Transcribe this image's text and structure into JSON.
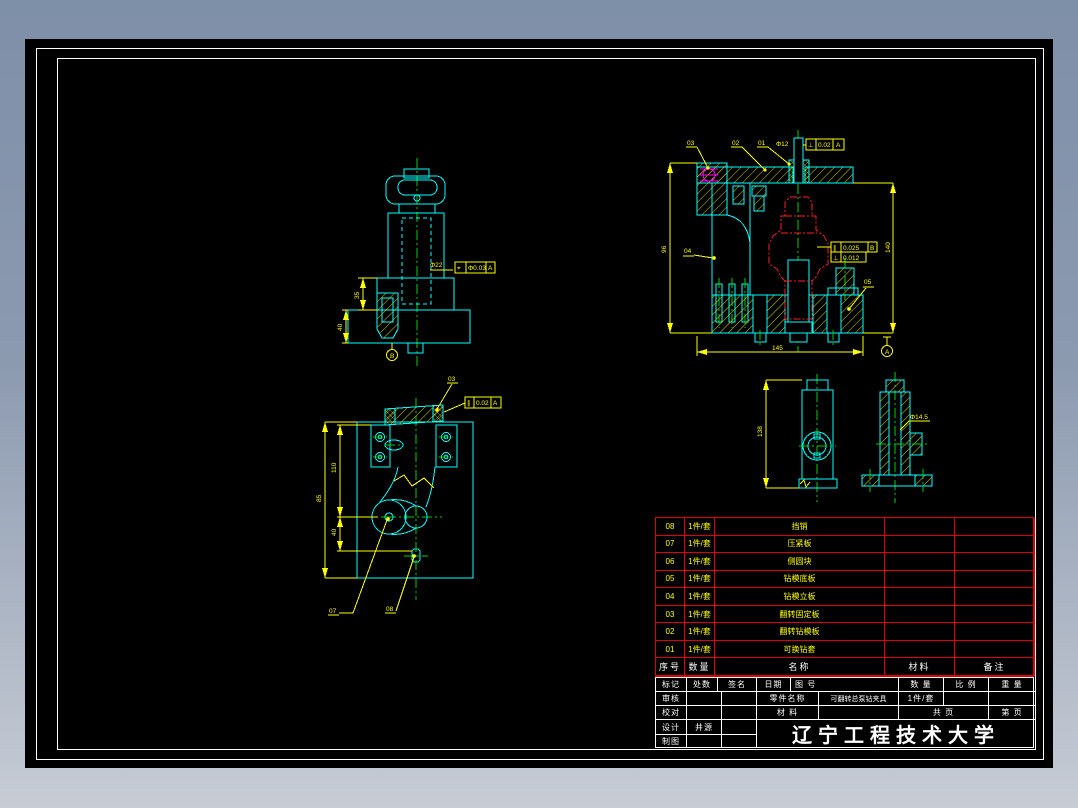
{
  "colors": {
    "background_top": "#7e8fa8",
    "background_bottom": "#c7ccd5",
    "canvas": "#000000",
    "geometry": "#00ffff",
    "dimension": "#ffff00",
    "centerline": "#00d000",
    "workpiece": "#ff2020",
    "table_grid": "#e00000",
    "frame": "#ffffff"
  },
  "views": {
    "front": {
      "dim_35": "35",
      "dim_40": "40",
      "dim_phi22": "Φ22",
      "fcf": {
        "sym": "⌖",
        "tol": "Φ0.03",
        "datum": "A"
      },
      "datum_b": "B"
    },
    "section": {
      "dim_left": "96",
      "dim_right": "140",
      "dim_bottom": "145",
      "dim_top": "Φ12",
      "fcf_top": {
        "sym": "⊥",
        "tol": "0.02",
        "datum": "A"
      },
      "fcf_par": {
        "sym": "∥",
        "tol": "0.025",
        "datum": "B"
      },
      "fcf_perp": {
        "sym": "⊥",
        "tol": "0.012"
      },
      "datum_a": "A",
      "balloon_01": "01",
      "balloon_02": "02",
      "balloon_03": "03",
      "balloon_04": "04",
      "balloon_05": "05"
    },
    "plan": {
      "dim_110": "110",
      "dim_40": "40",
      "dim_85": "85",
      "fcf": {
        "sym": "∥",
        "tol": "0.02",
        "datum": "A"
      },
      "balloon_03": "03",
      "balloon_07": "07",
      "balloon_08": "08"
    },
    "detail": {
      "dim_138": "138",
      "note": "Φ14.5"
    }
  },
  "parts_table": {
    "headers": [
      "序号",
      "数量",
      "名称",
      "材料",
      "备注"
    ],
    "rows": [
      {
        "no": "08",
        "qty": "1件/套",
        "name": "挡销"
      },
      {
        "no": "07",
        "qty": "1件/套",
        "name": "压紧板"
      },
      {
        "no": "06",
        "qty": "1件/套",
        "name": "侧圆块"
      },
      {
        "no": "05",
        "qty": "1件/套",
        "name": "钻模底板"
      },
      {
        "no": "04",
        "qty": "1件/套",
        "name": "钻模立板"
      },
      {
        "no": "03",
        "qty": "1件/套",
        "name": "翻转固定板"
      },
      {
        "no": "02",
        "qty": "1件/套",
        "name": "翻转钻模板"
      },
      {
        "no": "01",
        "qty": "1件/套",
        "name": "可换钻套"
      }
    ]
  },
  "title_block": {
    "mark": "标记",
    "count": "处数",
    "sign": "签名",
    "date": "日期",
    "drawing_no": "图 号",
    "qty_label": "数 量",
    "scale_label": "比 例",
    "weight_label": "重 量",
    "check": "审核",
    "part_name_label": "零件名称",
    "part_name": "可翻转总泵钻夹具",
    "qty_value": "1件/套",
    "proof": "校对",
    "material_label": "材 料",
    "total_pages": "共  页",
    "page_no": "第  页",
    "design": "设计",
    "designer": "井源",
    "draft": "制图",
    "university": "辽宁工程技术大学"
  }
}
